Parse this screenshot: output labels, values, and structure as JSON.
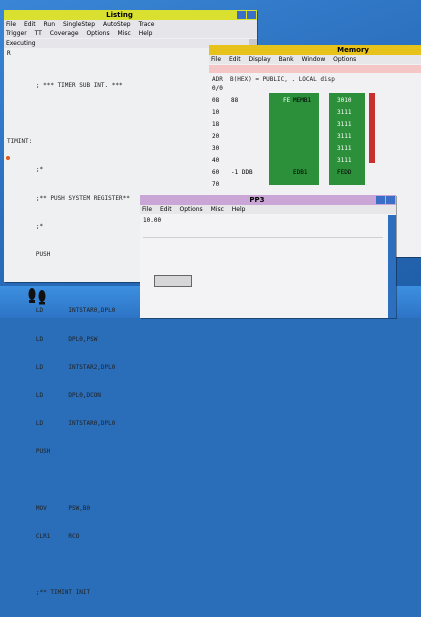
{
  "listing": {
    "title": "Listing",
    "menu_row1": [
      "File",
      "Edit",
      "Run",
      "SingleStep",
      "AutoStep",
      "Trace"
    ],
    "menu_row2": [
      "Trigger",
      "TT",
      "Coverage",
      "Options",
      "Misc",
      "Help"
    ],
    "status": "Executing",
    "prompt": "R",
    "lines": [
      "        ; *** TIMER SUB INT. ***",
      "",
      "TIMINT:",
      "        ;*",
      "        ;** PUSH SYSTEM REGISTER**",
      "        ;*",
      "        PUSH",
      "",
      "        LD       INTSTAR0,DPL0",
      "        LD       DPL0,PSW",
      "        LD       INTSTAR2,DPL0",
      "        LD       DPL0,DCON",
      "        LD       INTSTAR0,DPL0",
      "        PUSH",
      "",
      "        MOV      PSW,B0",
      "        CLR1     RCO",
      "",
      "        ;** TIMINT INIT"
    ]
  },
  "memory": {
    "title": "Memory",
    "menu": [
      "File",
      "Edit",
      "Display",
      "Bank",
      "Window",
      "Options"
    ],
    "header_line": "ADR  B(HEX) = PUBLIC, . LOCAL disp",
    "rows": [
      {
        "addr": "0/0",
        "v1": "",
        "v2": "",
        "v3": "",
        "v4": ""
      },
      {
        "addr": "08",
        "v1": "88",
        "v2": "FE",
        "v3": "MEMB1",
        "v4": "3010"
      },
      {
        "addr": "10",
        "v1": "",
        "v2": "",
        "v3": "",
        "v4": "3111"
      },
      {
        "addr": "18",
        "v1": "",
        "v2": "",
        "v3": "",
        "v4": "3111"
      },
      {
        "addr": "20",
        "v1": "",
        "v2": "",
        "v3": "",
        "v4": "3111"
      },
      {
        "addr": "30",
        "v1": "",
        "v2": "",
        "v3": "",
        "v4": "3111"
      },
      {
        "addr": "40",
        "v1": "",
        "v2": "",
        "v3": "",
        "v4": "3111"
      },
      {
        "addr": "60",
        "v1": "-1 DDB",
        "v2": "",
        "v3": "EDB1",
        "v4": "FEDD"
      },
      {
        "addr": "70",
        "v1": "",
        "v2": "",
        "v3": "",
        "v4": ""
      }
    ]
  },
  "pp": {
    "title": "PP3",
    "menu": [
      "File",
      "Edit",
      "Options",
      "Misc",
      "Help"
    ],
    "field": "10.00"
  },
  "colors": {
    "titlebar_listing": "#d9e030",
    "titlebar_memory": "#e6c21a",
    "titlebar_pp": "#c9a6d6",
    "menubar": "#e7e7ea",
    "window_bg": "#f1f1f3",
    "green": "#2c8f3a",
    "desktop": "#2b6fbe"
  }
}
